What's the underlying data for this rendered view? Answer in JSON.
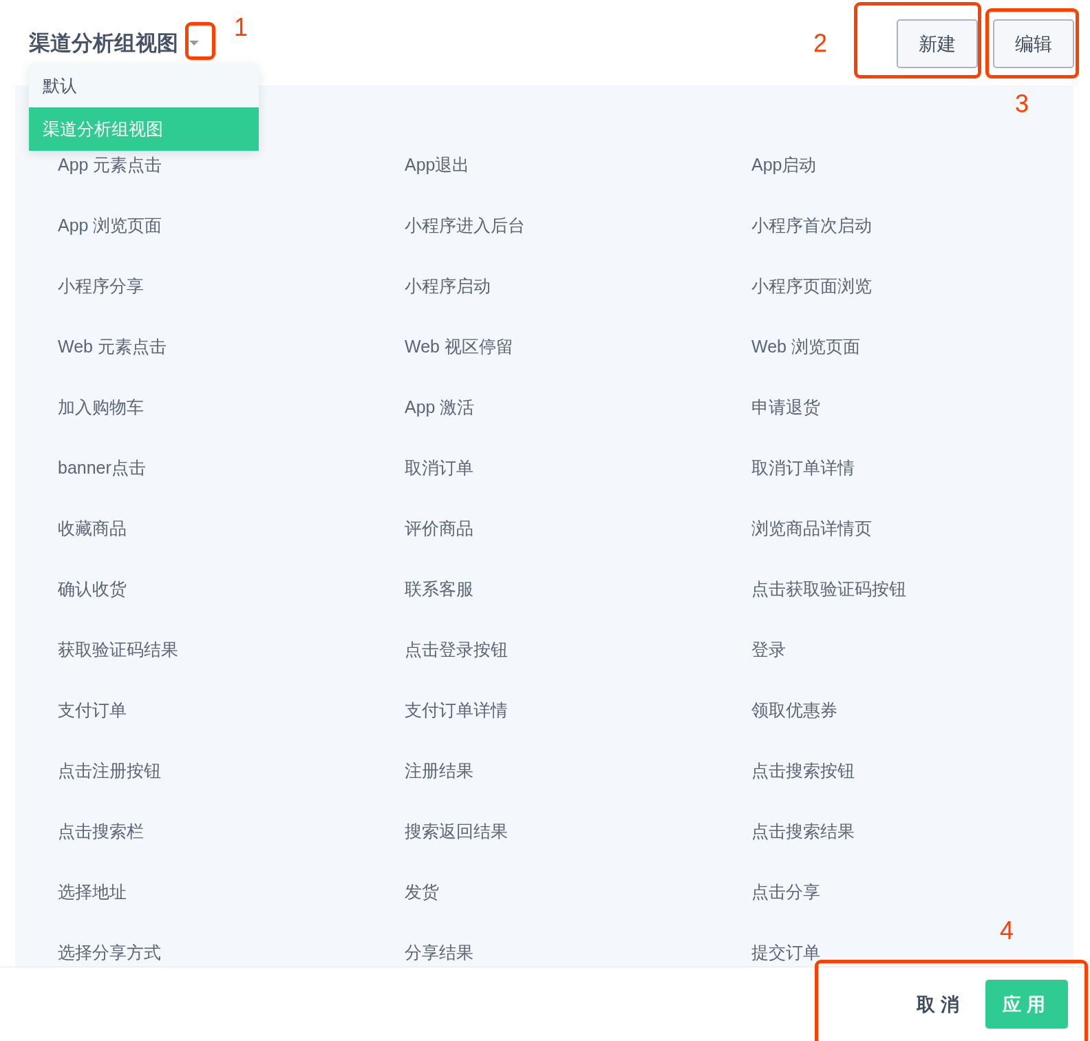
{
  "header": {
    "title": "渠道分析组视图",
    "buttons": [
      {
        "label": "新建"
      },
      {
        "label": "编辑"
      }
    ]
  },
  "dropdown_menu": {
    "expanded": true,
    "items": [
      {
        "label": "默认",
        "selected": false
      },
      {
        "label": "渠道分析组视图",
        "selected": true
      }
    ]
  },
  "events": [
    "App 元素点击",
    "App退出",
    "App启动",
    "App 浏览页面",
    "小程序进入后台",
    "小程序首次启动",
    "小程序分享",
    "小程序启动",
    "小程序页面浏览",
    "Web 元素点击",
    "Web 视区停留",
    "Web 浏览页面",
    "加入购物车",
    "App 激活",
    "申请退货",
    "banner点击",
    "取消订单",
    "取消订单详情",
    "收藏商品",
    "评价商品",
    "浏览商品详情页",
    "确认收货",
    "联系客服",
    "点击获取验证码按钮",
    "获取验证码结果",
    "点击登录按钮",
    "登录",
    "支付订单",
    "支付订单详情",
    "领取优惠券",
    "点击注册按钮",
    "注册结果",
    "点击搜索按钮",
    "点击搜索栏",
    "搜索返回结果",
    "点击搜索结果",
    "选择地址",
    "发货",
    "点击分享",
    "选择分享方式",
    "分享结果",
    "提交订单"
  ],
  "footer": {
    "cancel": "取消",
    "apply": "应用"
  },
  "annotations": [
    {
      "number": "1"
    },
    {
      "number": "2"
    },
    {
      "number": "3"
    },
    {
      "number": "4"
    }
  ]
}
